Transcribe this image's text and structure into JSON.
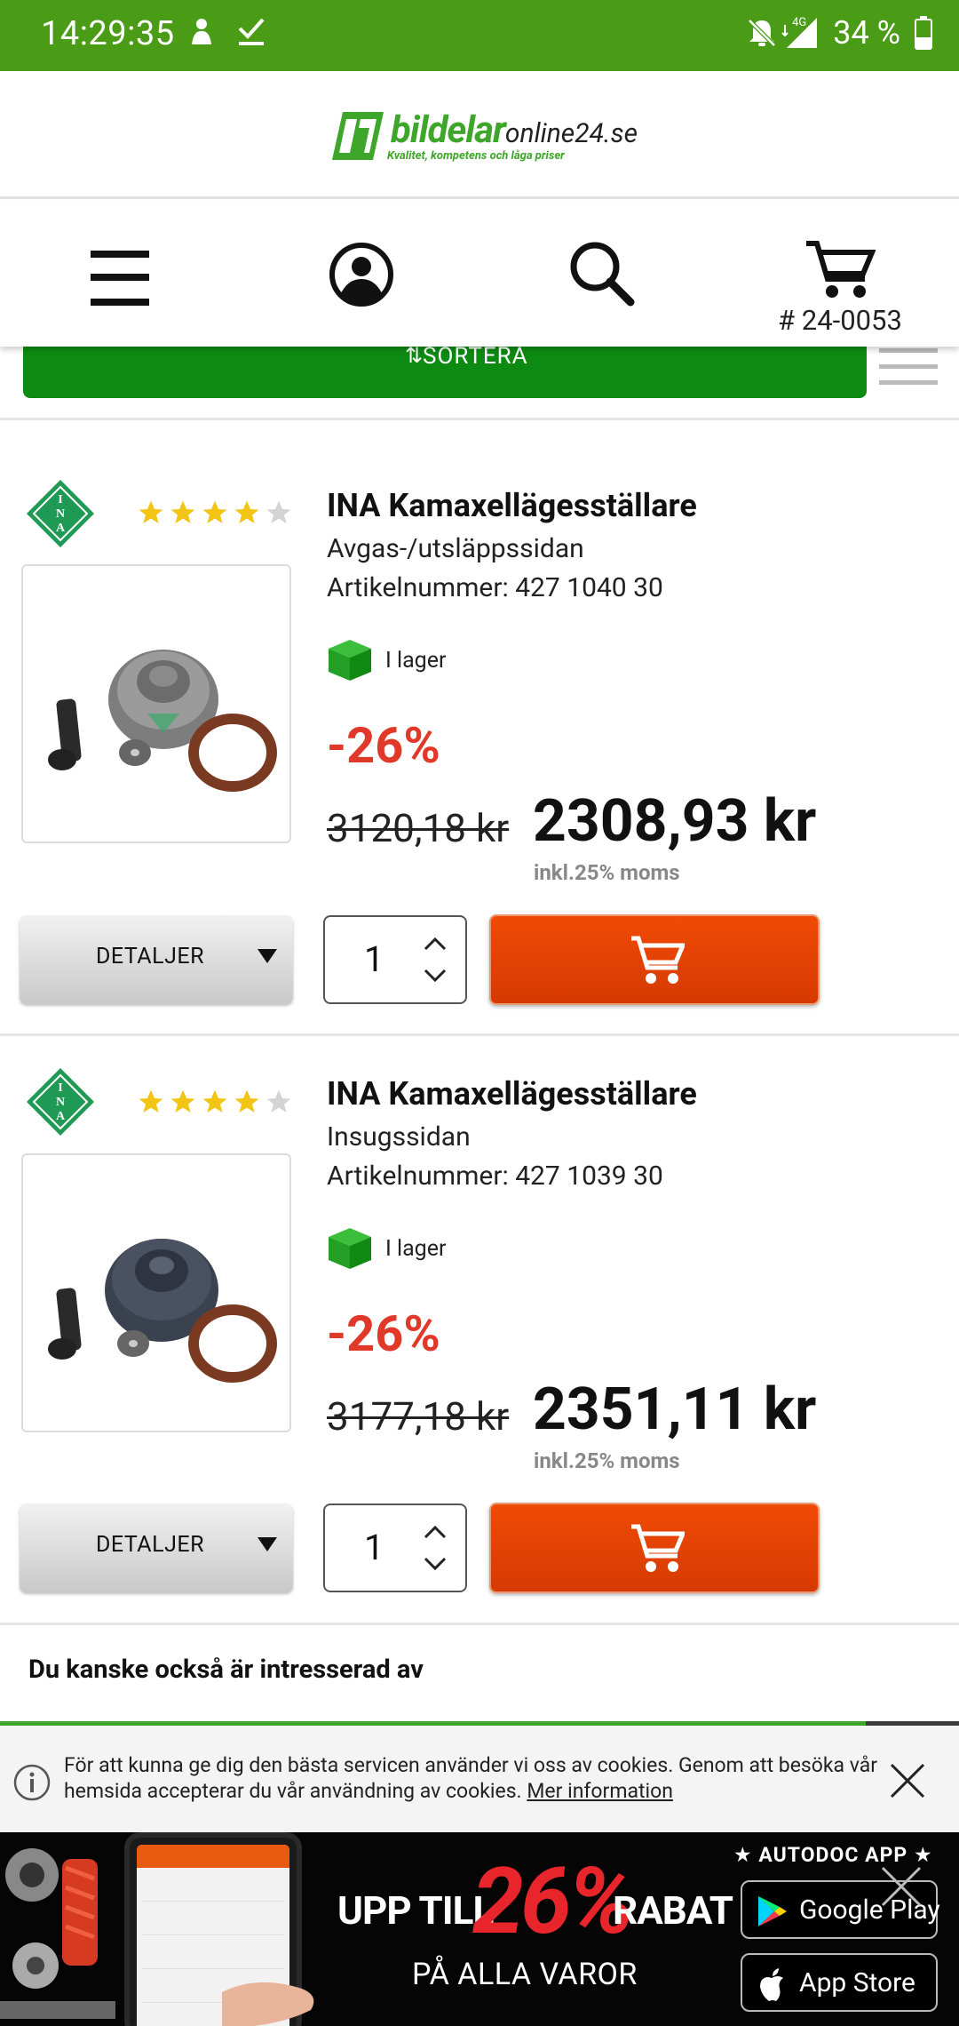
{
  "status_bar": {
    "time": "14:29:35",
    "network": "4G",
    "battery": "34 %"
  },
  "header": {
    "logo_main": "bildelar",
    "logo_tail": "online24.se",
    "logo_tagline": "Kvalitet, kompetens och låga priser",
    "cart_number": "# 24-0053"
  },
  "sort": {
    "arrows": "⇅",
    "label": "SORTERA"
  },
  "products": [
    {
      "brand": "INA",
      "rating": 4,
      "rating_max": 5,
      "title": "INA Kamaxellägesställare",
      "subtitle": "Avgas-/utsläppssidan",
      "article": "Artikelnummer: 427 1040 30",
      "stock": "I lager",
      "discount": "-26%",
      "old_price": "3120,18 kr",
      "price": "2308,93 kr",
      "vat": "inkl.25% moms",
      "details_label": "DETALJER",
      "quantity": "1"
    },
    {
      "brand": "INA",
      "rating": 4,
      "rating_max": 5,
      "title": "INA Kamaxellägesställare",
      "subtitle": "Insugssidan",
      "article": "Artikelnummer: 427 1039 30",
      "stock": "I lager",
      "discount": "-26%",
      "old_price": "3177,18 kr",
      "price": "2351,11 kr",
      "vat": "inkl.25% moms",
      "details_label": "DETALJER",
      "quantity": "1"
    }
  ],
  "related": {
    "heading": "Du kanske också är intresserad av"
  },
  "cookie": {
    "text": "För att kunna ge dig den bästa servicen använder vi oss av cookies. Genom att besöka vår hemsida accepterar du vår användning av cookies.",
    "link": "Mer information"
  },
  "ad": {
    "line1_prefix": "UPP TILL",
    "percent": "26%",
    "line1_suffix": "RABAT",
    "line2": "PÅ ALLA VAROR",
    "app_title": "★ AUTODOC APP ★",
    "google_play": "Google Play",
    "app_store": "App Store"
  },
  "colors": {
    "brand_green": "#3ea62a",
    "status_green": "#4a9b16",
    "sort_green": "#0d8a12",
    "discount_red": "#e0392a",
    "cart_orange": "#e44304",
    "star_yellow": "#f2c413"
  }
}
